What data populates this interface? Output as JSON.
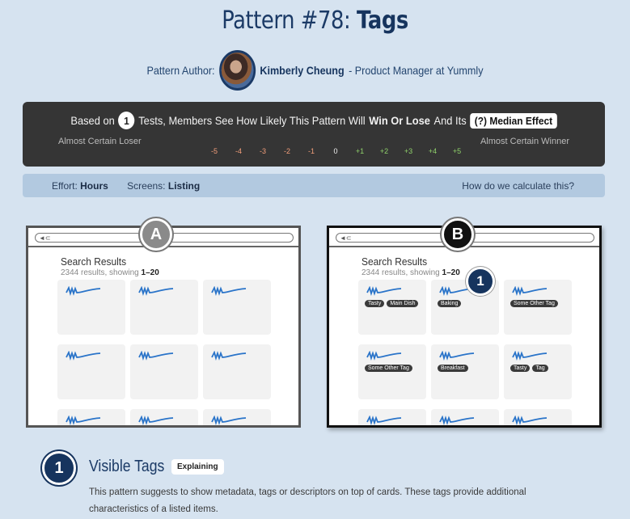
{
  "page": {
    "title_prefix": "Pattern #78:",
    "title_name": "Tags"
  },
  "author": {
    "label": "Pattern Author:",
    "name": "Kimberly Cheung",
    "role": "- Product Manager at Yummly"
  },
  "summary": {
    "prefix": "Based on",
    "test_count": "1",
    "middle": "Tests, Members See How Likely This Pattern Will",
    "win_lose": "Win Or Lose",
    "and_its": "And Its",
    "median_label": "(?) Median Effect",
    "left_label": "Almost Certain Loser",
    "right_label": "Almost Certain Winner",
    "scale": [
      "-5",
      "-4",
      "-3",
      "-2",
      "-1",
      "0",
      "+1",
      "+2",
      "+3",
      "+4",
      "+5"
    ],
    "scale_colors": [
      "#f29e7a",
      "#f29e7a",
      "#f29e7a",
      "#f29e7a",
      "#f29e7a",
      "#f0f0f0",
      "#8fd16b",
      "#8fd16b",
      "#8fd16b",
      "#8fd16b",
      "#8fd16b"
    ]
  },
  "meta": {
    "effort_label": "Effort:",
    "effort_value": "Hours",
    "screens_label": "Screens:",
    "screens_value": "Listing",
    "how_link": "How do we calculate this?"
  },
  "variant_a": {
    "badge": "A",
    "badge_color": "#8a8a8a",
    "title": "Search Results",
    "subtitle": "2344 results, showing",
    "subtitle_bold": "1–20"
  },
  "variant_b": {
    "badge": "B",
    "badge_color": "#111111",
    "title": "Search Results",
    "subtitle": "2344 results, showing",
    "subtitle_bold": "1–20",
    "tags": [
      [
        "Tasty",
        "Main Dish"
      ],
      [
        "Baking"
      ],
      [
        "Some Other Tag"
      ],
      [
        "Some Other Tag"
      ],
      [
        "Breakfast"
      ],
      [
        "Tasty",
        "Tag"
      ]
    ]
  },
  "marker": "1",
  "detail": {
    "number": "1",
    "title": "Visible Tags",
    "badge": "Explaining",
    "description": "This pattern suggests to show metadata, tags or descriptors on top of cards. These tags provide additional characteristics of a listed items."
  }
}
